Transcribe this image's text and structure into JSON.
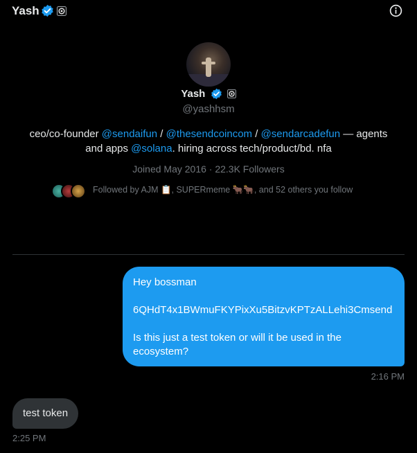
{
  "header": {
    "name": "Yash"
  },
  "profile": {
    "name": "Yash",
    "handle": "@yashhsm",
    "bio": {
      "part1": "ceo/co-founder ",
      "link1": "@sendaifun",
      "sep1": " / ",
      "link2": "@thesendcoincom",
      "sep2": " / ",
      "link3": "@sendarcadefun",
      "part2": " — agents and apps ",
      "link4": "@solana",
      "part3": ". hiring across tech/product/bd. nfa"
    },
    "joined": "Joined May 2016 · 22.3K Followers",
    "followed_by": "Followed by AJM 📋, SUPERmeme 🐂🐂, and 52 others you follow"
  },
  "messages": {
    "outgoing": {
      "line1": "Hey bossman",
      "line2": "6QHdT4x1BWmuFKYPixXu5BitzvKPTzALLehi3Cmsend",
      "line3": "Is this just a test token or will it be used in the ecosystem?",
      "time": "2:16 PM"
    },
    "incoming": {
      "text": "test token",
      "time": "2:25 PM"
    }
  },
  "colors": {
    "accent": "#1d9bf0",
    "background": "#000000",
    "muted": "#71767b",
    "incoming_bubble": "#2f3336"
  }
}
